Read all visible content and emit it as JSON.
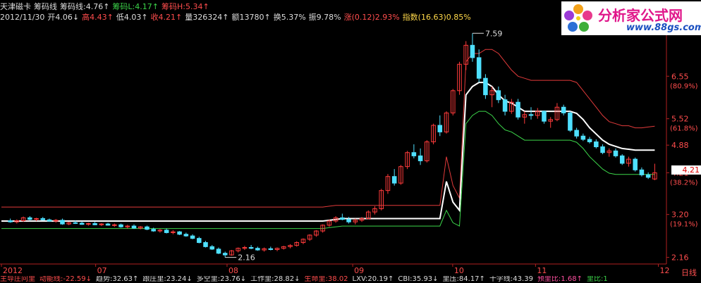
{
  "header": {
    "line1": [
      {
        "text": "天津磁卡",
        "cls": "w"
      },
      {
        "text": "筹码线",
        "cls": "w"
      },
      {
        "text": "筹码线:4.76↑",
        "cls": "w"
      },
      {
        "text": "筹码L:4.17↑",
        "cls": "g"
      },
      {
        "text": "筹码H:5.34↑",
        "cls": "r"
      }
    ],
    "line2": [
      {
        "text": "2012/11/30",
        "cls": "w"
      },
      {
        "text": "开4.06↓",
        "cls": "w"
      },
      {
        "text": "高4.43↑",
        "cls": "r"
      },
      {
        "text": "低4.03↑",
        "cls": "w"
      },
      {
        "text": "收4.21↑",
        "cls": "r"
      },
      {
        "text": "量326324↑",
        "cls": "w"
      },
      {
        "text": "额13780↑",
        "cls": "w"
      },
      {
        "text": "换5.37%",
        "cls": "w"
      },
      {
        "text": "振9.78%",
        "cls": "w"
      },
      {
        "text": "涨(0.12)2.93%",
        "cls": "r"
      },
      {
        "text": "指数(16.63)0.85%",
        "cls": "yel"
      }
    ]
  },
  "logo": {
    "title": "分析家公式网",
    "url": "www.88gs.com"
  },
  "bottom_indicators": [
    {
      "text": "主导庄问里",
      "cls": "r"
    },
    {
      "text": "动能线:-22.59↓",
      "cls": "r"
    },
    {
      "text": "趋势:32.63↑",
      "cls": "w"
    },
    {
      "text": "跟庄里:23.24↓",
      "cls": "w"
    },
    {
      "text": "多空里:23.76↓",
      "cls": "w"
    },
    {
      "text": "工作里:28.82↓",
      "cls": "w"
    },
    {
      "text": "生命里:38.02",
      "cls": "r"
    },
    {
      "text": "LXV:20.19↑",
      "cls": "w"
    },
    {
      "text": "CBI:35.93↓",
      "cls": "w"
    },
    {
      "text": "里压:84.17↑",
      "cls": "w"
    },
    {
      "text": "十字线:43.39",
      "cls": "w"
    },
    {
      "text": "预里比:1.68↑",
      "cls": "pk"
    },
    {
      "text": "里比:1",
      "cls": "g"
    }
  ],
  "day_label": "日线",
  "current_price": "4.21",
  "chart_data": {
    "type": "candlestick",
    "x_ticks": [
      "2012",
      "07",
      "08",
      "09",
      "10",
      "11",
      "12"
    ],
    "y_ticks": [
      {
        "v": 6.55,
        "label": "6.55",
        "pct": "(80.9%)"
      },
      {
        "v": 5.52,
        "label": "5.52",
        "pct": "(61.8%)"
      },
      {
        "v": 4.88,
        "label": "4.88",
        "pct": ""
      },
      {
        "v": 4.21,
        "label": "4.21",
        "pct": "(38.2%)"
      },
      {
        "v": 3.2,
        "label": "3.20",
        "pct": "(19.1%)"
      },
      {
        "v": 2.16,
        "label": "2.16",
        "pct": ""
      }
    ],
    "annotations": [
      {
        "text": "7.59",
        "value": 7.59
      },
      {
        "text": "2.16",
        "value": 2.16
      }
    ],
    "ylim": [
      2.0,
      7.8
    ],
    "candles": [
      [
        3.05,
        3.1,
        3.0,
        3.02
      ],
      [
        3.02,
        3.08,
        2.98,
        3.05
      ],
      [
        3.05,
        3.15,
        3.02,
        3.12
      ],
      [
        3.12,
        3.16,
        3.05,
        3.08
      ],
      [
        3.08,
        3.12,
        3.04,
        3.1
      ],
      [
        3.1,
        3.14,
        3.06,
        3.07
      ],
      [
        3.07,
        3.1,
        3.02,
        3.04
      ],
      [
        3.04,
        3.09,
        3.0,
        3.06
      ],
      [
        3.06,
        3.1,
        2.95,
        2.97
      ],
      [
        2.97,
        3.02,
        2.94,
        3.0
      ],
      [
        3.0,
        3.05,
        2.97,
        2.99
      ],
      [
        2.99,
        3.03,
        2.95,
        2.96
      ],
      [
        2.96,
        3.0,
        2.93,
        2.98
      ],
      [
        2.98,
        3.02,
        2.94,
        2.95
      ],
      [
        2.95,
        2.99,
        2.92,
        2.97
      ],
      [
        2.97,
        3.0,
        2.93,
        2.94
      ],
      [
        2.94,
        2.98,
        2.9,
        2.95
      ],
      [
        2.95,
        2.98,
        2.88,
        2.9
      ],
      [
        2.9,
        2.95,
        2.86,
        2.92
      ],
      [
        2.92,
        2.96,
        2.85,
        2.87
      ],
      [
        2.87,
        2.92,
        2.84,
        2.9
      ],
      [
        2.9,
        2.93,
        2.82,
        2.84
      ],
      [
        2.84,
        2.88,
        2.78,
        2.8
      ],
      [
        2.8,
        2.85,
        2.76,
        2.82
      ],
      [
        2.82,
        2.86,
        2.74,
        2.76
      ],
      [
        2.76,
        2.82,
        2.72,
        2.78
      ],
      [
        2.78,
        2.8,
        2.7,
        2.72
      ],
      [
        2.72,
        2.76,
        2.66,
        2.68
      ],
      [
        2.68,
        2.72,
        2.6,
        2.62
      ],
      [
        2.62,
        2.66,
        2.5,
        2.52
      ],
      [
        2.52,
        2.56,
        2.4,
        2.42
      ],
      [
        2.42,
        2.46,
        2.34,
        2.36
      ],
      [
        2.36,
        2.4,
        2.24,
        2.26
      ],
      [
        2.26,
        2.3,
        2.16,
        2.22
      ],
      [
        2.22,
        2.34,
        2.2,
        2.32
      ],
      [
        2.32,
        2.4,
        2.28,
        2.38
      ],
      [
        2.38,
        2.44,
        2.34,
        2.4
      ],
      [
        2.4,
        2.46,
        2.36,
        2.38
      ],
      [
        2.38,
        2.42,
        2.32,
        2.34
      ],
      [
        2.34,
        2.4,
        2.3,
        2.37
      ],
      [
        2.37,
        2.42,
        2.33,
        2.35
      ],
      [
        2.35,
        2.4,
        2.31,
        2.38
      ],
      [
        2.38,
        2.44,
        2.35,
        2.42
      ],
      [
        2.42,
        2.48,
        2.38,
        2.45
      ],
      [
        2.45,
        2.55,
        2.42,
        2.52
      ],
      [
        2.52,
        2.62,
        2.48,
        2.6
      ],
      [
        2.6,
        2.72,
        2.56,
        2.7
      ],
      [
        2.7,
        2.82,
        2.66,
        2.8
      ],
      [
        2.8,
        2.96,
        2.76,
        2.94
      ],
      [
        2.94,
        3.08,
        2.9,
        3.04
      ],
      [
        3.04,
        3.16,
        3.0,
        3.12
      ],
      [
        3.12,
        3.22,
        3.06,
        3.08
      ],
      [
        3.08,
        3.14,
        2.98,
        3.02
      ],
      [
        3.02,
        3.1,
        2.96,
        3.06
      ],
      [
        3.06,
        3.14,
        3.02,
        3.1
      ],
      [
        3.1,
        3.3,
        3.08,
        3.26
      ],
      [
        3.26,
        3.4,
        3.2,
        3.34
      ],
      [
        3.34,
        3.82,
        3.3,
        3.78
      ],
      [
        3.78,
        4.18,
        3.7,
        4.12
      ],
      [
        4.12,
        4.3,
        3.9,
        3.96
      ],
      [
        3.96,
        4.4,
        3.92,
        4.36
      ],
      [
        4.36,
        4.74,
        4.3,
        4.7
      ],
      [
        4.7,
        4.9,
        4.56,
        4.62
      ],
      [
        4.62,
        4.8,
        4.4,
        4.5
      ],
      [
        4.5,
        5.0,
        4.46,
        4.96
      ],
      [
        4.96,
        5.4,
        4.9,
        5.36
      ],
      [
        5.36,
        5.6,
        5.1,
        5.2
      ],
      [
        5.2,
        5.7,
        5.16,
        5.66
      ],
      [
        5.66,
        6.24,
        5.6,
        6.2
      ],
      [
        6.2,
        6.9,
        6.1,
        6.84
      ],
      [
        6.84,
        7.4,
        6.7,
        7.3
      ],
      [
        7.3,
        7.59,
        6.9,
        7.0
      ],
      [
        7.0,
        7.2,
        6.4,
        6.5
      ],
      [
        6.5,
        6.6,
        6.0,
        6.1
      ],
      [
        6.1,
        6.3,
        5.8,
        6.2
      ],
      [
        6.2,
        6.3,
        5.9,
        5.98
      ],
      [
        5.98,
        6.1,
        5.6,
        5.7
      ],
      [
        5.7,
        6.0,
        5.64,
        5.92
      ],
      [
        5.92,
        6.0,
        5.5,
        5.56
      ],
      [
        5.56,
        5.7,
        5.4,
        5.62
      ],
      [
        5.62,
        5.8,
        5.5,
        5.6
      ],
      [
        5.6,
        5.78,
        5.52,
        5.7
      ],
      [
        5.7,
        5.72,
        5.4,
        5.46
      ],
      [
        5.46,
        5.56,
        5.3,
        5.5
      ],
      [
        5.5,
        5.9,
        5.46,
        5.8
      ],
      [
        5.8,
        5.86,
        5.6,
        5.66
      ],
      [
        5.66,
        5.7,
        5.2,
        5.24
      ],
      [
        5.24,
        5.3,
        5.04,
        5.1
      ],
      [
        5.1,
        5.16,
        4.98,
        5.02
      ],
      [
        5.02,
        5.08,
        4.92,
        4.96
      ],
      [
        4.96,
        5.02,
        4.8,
        4.84
      ],
      [
        4.84,
        4.9,
        4.66,
        4.7
      ],
      [
        4.7,
        4.8,
        4.6,
        4.74
      ],
      [
        4.74,
        4.8,
        4.58,
        4.62
      ],
      [
        4.62,
        4.66,
        4.4,
        4.44
      ],
      [
        4.44,
        4.6,
        4.36,
        4.54
      ],
      [
        4.54,
        4.58,
        4.24,
        4.28
      ],
      [
        4.28,
        4.34,
        4.12,
        4.16
      ],
      [
        4.16,
        4.22,
        4.06,
        4.1
      ],
      [
        4.06,
        4.43,
        4.03,
        4.21
      ]
    ],
    "series": [
      {
        "name": "筹码H",
        "color": "#e23b3b",
        "values": [
          3.38,
          3.38,
          3.38,
          3.38,
          3.38,
          3.38,
          3.38,
          3.38,
          3.38,
          3.38,
          3.38,
          3.38,
          3.38,
          3.38,
          3.38,
          3.38,
          3.38,
          3.38,
          3.38,
          3.38,
          3.38,
          3.38,
          3.38,
          3.38,
          3.38,
          3.38,
          3.38,
          3.38,
          3.38,
          3.38,
          3.38,
          3.38,
          3.38,
          3.38,
          3.38,
          3.38,
          3.38,
          3.38,
          3.38,
          3.38,
          3.38,
          3.38,
          3.38,
          3.38,
          3.38,
          3.38,
          3.38,
          3.38,
          3.38,
          3.4,
          3.42,
          3.42,
          3.42,
          3.42,
          3.42,
          3.42,
          3.42,
          3.42,
          3.42,
          3.42,
          3.42,
          3.42,
          3.42,
          3.42,
          3.42,
          3.42,
          3.42,
          4.6,
          3.9,
          3.6,
          6.9,
          7.1,
          7.1,
          7.2,
          7.2,
          7.1,
          6.9,
          6.7,
          6.55,
          6.5,
          6.45,
          6.45,
          6.45,
          6.45,
          6.45,
          6.45,
          6.45,
          6.4,
          6.2,
          6.0,
          5.8,
          5.6,
          5.45,
          5.4,
          5.35,
          5.35,
          5.3,
          5.3,
          5.32,
          5.34
        ]
      },
      {
        "name": "筹码线",
        "color": "#ffffff",
        "values": [
          3.04,
          3.04,
          3.04,
          3.04,
          3.04,
          3.04,
          3.04,
          3.04,
          3.04,
          3.04,
          3.04,
          3.04,
          3.04,
          3.04,
          3.04,
          3.04,
          3.04,
          3.04,
          3.04,
          3.04,
          3.04,
          3.04,
          3.04,
          3.04,
          3.04,
          3.04,
          3.04,
          3.04,
          3.04,
          3.04,
          3.04,
          3.04,
          3.04,
          3.04,
          3.04,
          3.04,
          3.04,
          3.04,
          3.04,
          3.04,
          3.04,
          3.04,
          3.04,
          3.04,
          3.04,
          3.04,
          3.04,
          3.04,
          3.04,
          3.06,
          3.08,
          3.1,
          3.1,
          3.1,
          3.1,
          3.1,
          3.1,
          3.1,
          3.1,
          3.1,
          3.1,
          3.1,
          3.1,
          3.1,
          3.1,
          3.1,
          3.1,
          4.0,
          3.5,
          3.3,
          6.1,
          6.3,
          6.4,
          6.4,
          6.3,
          6.1,
          5.95,
          5.9,
          5.8,
          5.7,
          5.7,
          5.7,
          5.7,
          5.7,
          5.7,
          5.7,
          5.7,
          5.65,
          5.5,
          5.3,
          5.15,
          5.0,
          4.9,
          4.85,
          4.8,
          4.78,
          4.76,
          4.76,
          4.76,
          4.76
        ]
      },
      {
        "name": "筹码L",
        "color": "#3cd54a",
        "values": [
          2.86,
          2.86,
          2.86,
          2.86,
          2.86,
          2.86,
          2.86,
          2.86,
          2.86,
          2.86,
          2.86,
          2.86,
          2.86,
          2.86,
          2.86,
          2.86,
          2.86,
          2.86,
          2.86,
          2.86,
          2.86,
          2.86,
          2.86,
          2.86,
          2.86,
          2.86,
          2.86,
          2.86,
          2.86,
          2.86,
          2.86,
          2.86,
          2.86,
          2.86,
          2.86,
          2.86,
          2.86,
          2.86,
          2.86,
          2.86,
          2.86,
          2.86,
          2.86,
          2.86,
          2.86,
          2.86,
          2.86,
          2.86,
          2.86,
          2.88,
          2.9,
          2.92,
          2.92,
          2.92,
          2.92,
          2.92,
          2.92,
          2.92,
          2.92,
          2.92,
          2.92,
          2.92,
          2.92,
          2.92,
          2.92,
          2.92,
          2.92,
          3.3,
          3.0,
          2.92,
          5.4,
          5.6,
          5.7,
          5.7,
          5.6,
          5.4,
          5.25,
          5.2,
          5.1,
          5.0,
          5.0,
          5.0,
          5.0,
          5.0,
          5.0,
          5.0,
          5.0,
          4.95,
          4.8,
          4.6,
          4.45,
          4.3,
          4.2,
          4.17,
          4.17,
          4.17,
          4.17,
          4.17,
          4.17,
          4.17
        ]
      }
    ]
  }
}
